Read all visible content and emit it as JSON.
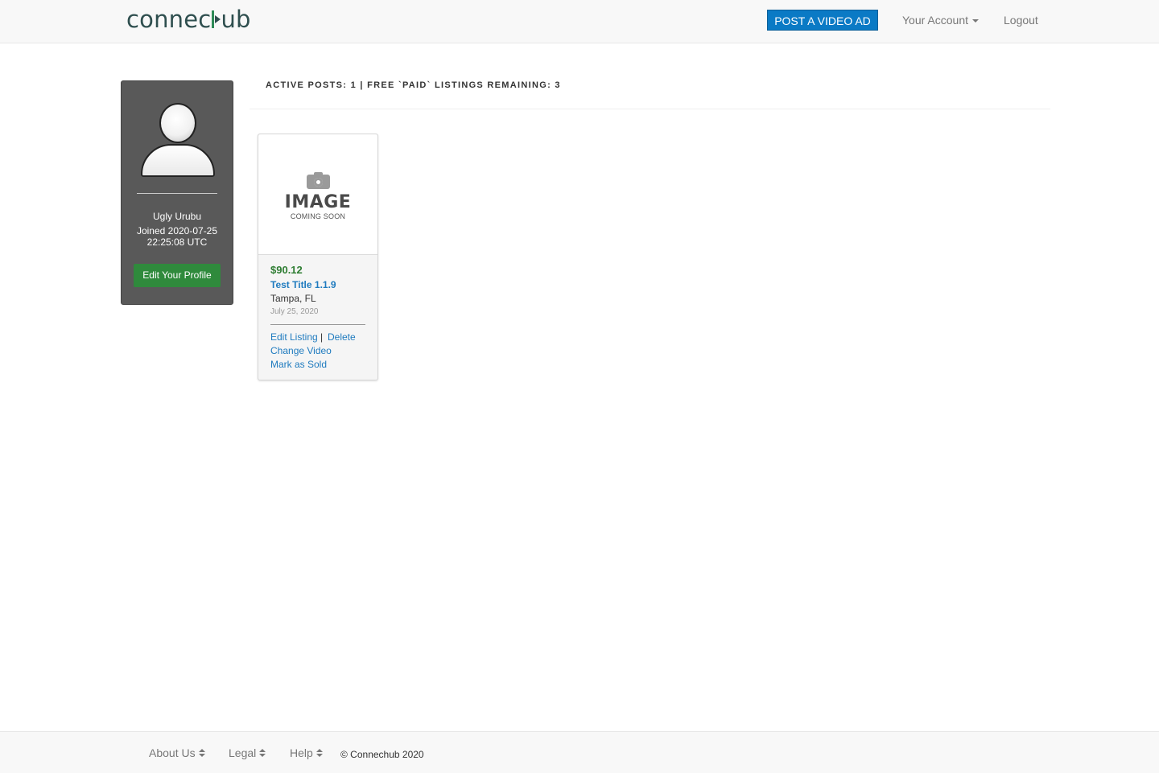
{
  "header": {
    "logo_left": "connec",
    "logo_right": "ub",
    "post_button": "POST A VIDEO AD",
    "account_label": "Your Account",
    "logout_label": "Logout"
  },
  "profile": {
    "name": "Ugly Urubu",
    "joined": "Joined 2020-07-25 22:25:08 UTC",
    "edit_button": "Edit Your Profile"
  },
  "stats": {
    "text": "ACTIVE POSTS: 1 | FREE `PAID` LISTINGS REMAINING: 3"
  },
  "listing": {
    "placeholder_title": "IMAGE",
    "placeholder_sub": "COMING SOON",
    "price": "$90.12",
    "title": "Test Title 1.1.9",
    "location": "Tampa, FL",
    "date": "July 25, 2020",
    "edit": "Edit Listing",
    "separator": "|",
    "delete": "Delete",
    "change_video": "Change Video",
    "mark_sold": "Mark as Sold"
  },
  "footer": {
    "about": "About Us",
    "legal": "Legal",
    "help": "Help",
    "copyright": "© Connechub 2020"
  },
  "colors": {
    "accent_blue": "#0a7ac5",
    "green_button": "#2f8a3c",
    "price_green": "#2e7d32",
    "link_blue": "#1f7bbf"
  },
  "icons": [
    "play-icon",
    "caret-down-icon",
    "avatar-icon",
    "camera-icon",
    "sort-icon"
  ]
}
